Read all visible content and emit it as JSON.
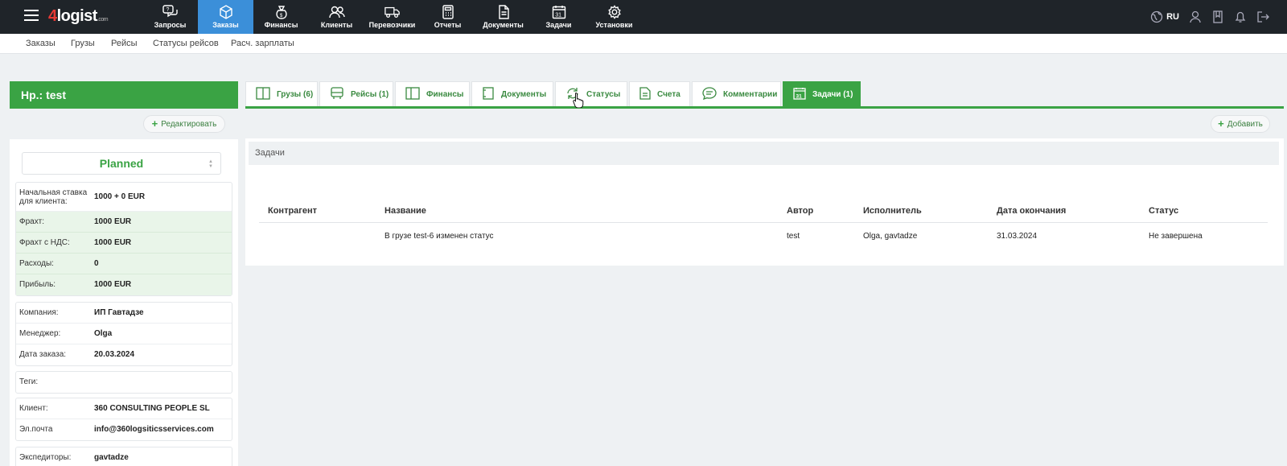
{
  "topbar": {
    "logo": {
      "four": "4",
      "rest": "logist",
      "com": ".com"
    },
    "nav": [
      {
        "label": "Запросы",
        "icon": "requests-icon"
      },
      {
        "label": "Заказы",
        "icon": "orders-icon",
        "active": true
      },
      {
        "label": "Финансы",
        "icon": "finance-icon"
      },
      {
        "label": "Клиенты",
        "icon": "clients-icon"
      },
      {
        "label": "Перевозчики",
        "icon": "truck-icon"
      },
      {
        "label": "Отчеты",
        "icon": "calculator-icon"
      },
      {
        "label": "Документы",
        "icon": "document-icon"
      },
      {
        "label": "Задачи",
        "icon": "calendar-icon"
      },
      {
        "label": "Установки",
        "icon": "gear-icon"
      }
    ],
    "lang": "RU"
  },
  "subnav": [
    "Заказы",
    "Грузы",
    "Рейсы",
    "Статусы рейсов",
    "Расч. зарплаты"
  ],
  "left": {
    "title": "Нр.: test",
    "edit_label": "Редактировать",
    "status": "Planned",
    "finance": [
      {
        "k": "Начальная ставка для клиента:",
        "v": "1000 + 0 EUR"
      },
      {
        "k": "Фрахт:",
        "v": "1000 EUR"
      },
      {
        "k": "Фрахт с НДС:",
        "v": "1000 EUR"
      },
      {
        "k": "Расходы:",
        "v": "0"
      },
      {
        "k": "Прибыль:",
        "v": "1000 EUR"
      }
    ],
    "info": [
      {
        "k": "Компания:",
        "v": "ИП Гавтадзе"
      },
      {
        "k": "Менеджер:",
        "v": "Olga"
      },
      {
        "k": "Дата заказа:",
        "v": "20.03.2024"
      }
    ],
    "tags": {
      "k": "Теги:",
      "v": ""
    },
    "client": [
      {
        "k": "Клиент:",
        "v": "360 CONSULTING PEOPLE SL"
      },
      {
        "k": "Эл.почта",
        "v": "info@360logsiticsservices.com"
      }
    ],
    "forwarders": {
      "k": "Экспедиторы:",
      "v": "gavtadze"
    }
  },
  "tabs": [
    {
      "label": "Грузы (6)",
      "icon": "cargo-icon"
    },
    {
      "label": "Рейсы (1)",
      "icon": "bus-icon"
    },
    {
      "label": "Финансы",
      "icon": "finance-tab-icon"
    },
    {
      "label": "Документы",
      "icon": "documents-tab-icon"
    },
    {
      "label": "Статусы",
      "icon": "statuses-icon"
    },
    {
      "label": "Счета",
      "icon": "invoice-icon"
    },
    {
      "label": "Комментарии",
      "icon": "comment-icon"
    },
    {
      "label": "Задачи (1)",
      "icon": "calendar-tab-icon",
      "active": true
    }
  ],
  "main": {
    "add_label": "Добавить",
    "panel_title": "Задачи",
    "columns": [
      "Контрагент",
      "Название",
      "Автор",
      "Исполнитель",
      "Дата окончания",
      "Статус"
    ],
    "rows": [
      [
        "",
        "В грузе test-6 изменен статус",
        "test",
        "Olga, gavtadze",
        "31.03.2024",
        "Не завершена"
      ]
    ]
  },
  "colors": {
    "accent_green": "#3aa344",
    "active_nav_blue": "#3b8fd9",
    "topbar_dark": "#1f2429"
  }
}
